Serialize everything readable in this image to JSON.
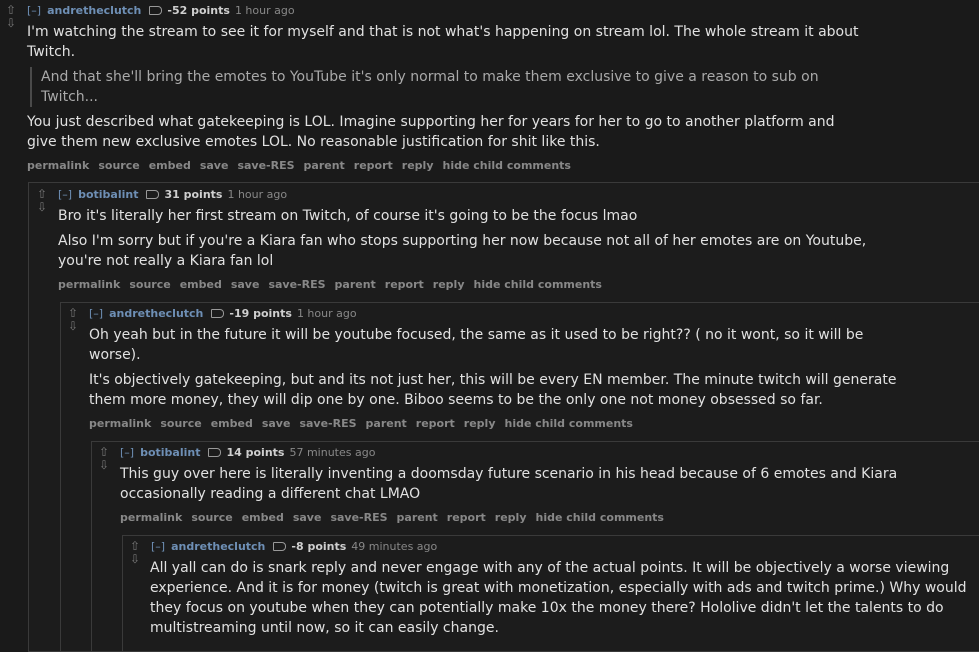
{
  "buttons": [
    "permalink",
    "source",
    "embed",
    "save",
    "save-RES",
    "parent",
    "report",
    "reply",
    "hide child comments"
  ],
  "toggle_label": "[–]",
  "comments": [
    {
      "author": "andretheclutch",
      "score": "-52 points",
      "time": "1 hour ago",
      "para1": "I'm watching the stream to see it for myself and that is not what's happening on stream lol. The whole stream it about Twitch.",
      "quote": "And that she'll bring the emotes to YouTube it's only normal to make them exclusive to give a reason to sub on Twitch...",
      "para2": "You just described what gatekeeping is LOL. Imagine supporting her for years for her to go to another platform and give them new exclusive emotes LOL. No reasonable justification for shit like this."
    },
    {
      "author": "botibalint",
      "score": "31 points",
      "time": "1 hour ago",
      "para1": "Bro it's literally her first stream on Twitch, of course it's going to be the focus lmao",
      "para2": "Also I'm sorry but if you're a Kiara fan who stops supporting her now because not all of her emotes are on Youtube, you're not really a Kiara fan lol"
    },
    {
      "author": "andretheclutch",
      "score": "-19 points",
      "time": "1 hour ago",
      "para1": "Oh yeah but in the future it will be youtube focused, the same as it used to be right?? ( no it wont, so it will be worse).",
      "para2": "It's objectively gatekeeping, but and its not just her, this will be every EN member. The minute twitch will generate them more money, they will dip one by one. Biboo seems to be the only one not money obsessed so far."
    },
    {
      "author": "botibalint",
      "score": "14 points",
      "time": "57 minutes ago",
      "para1": "This guy over here is literally inventing a doomsday future scenario in his head because of 6 emotes and Kiara occasionally reading a different chat LMAO"
    },
    {
      "author": "andretheclutch",
      "score": "-8 points",
      "time": "49 minutes ago",
      "para1": "All yall can do is snark reply and never engage with any of the actual points. It will be objectively a worse viewing experience. And it is for money (twitch is great with monetization, especially with ads and twitch prime.) Why would they focus on youtube when they can potentially make 10x the money there? Hololive didn't let the talents to do multistreaming until now, so it can easily change."
    }
  ]
}
